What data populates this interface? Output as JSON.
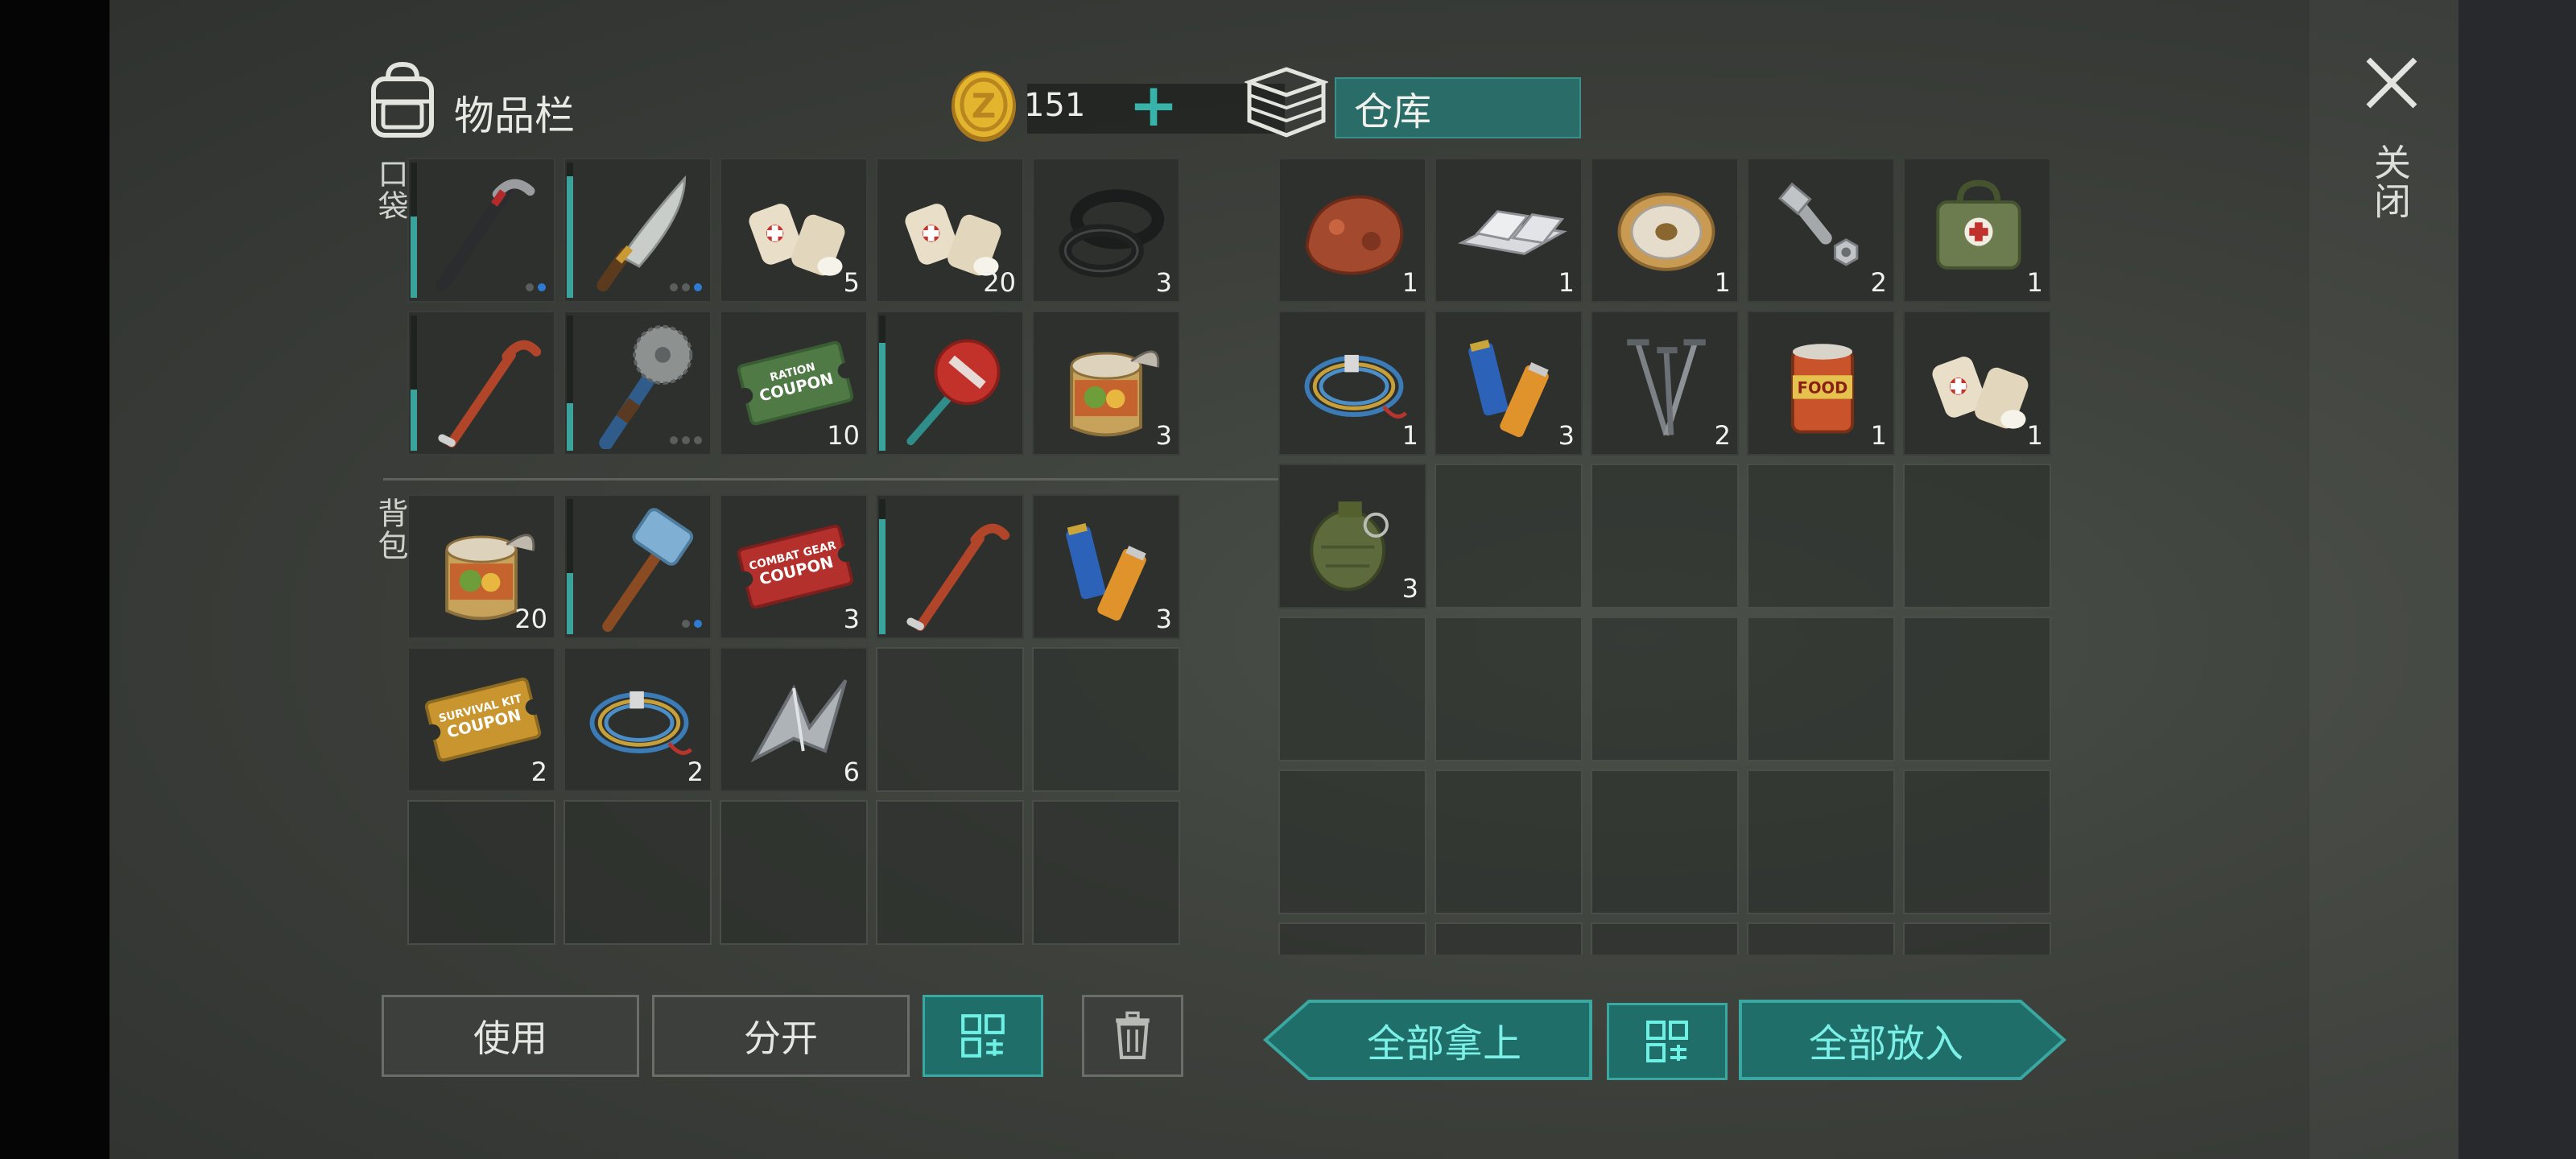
{
  "inventory": {
    "title": "物品栏",
    "coins": "151",
    "pocket_label": "口袋",
    "backpack_label": "背包"
  },
  "storage": {
    "title": "仓库"
  },
  "close_label": "关闭",
  "pocket_items": [
    {
      "name": "crowbar-bar",
      "count": "",
      "dots": [
        false,
        true
      ],
      "bar": 0.6
    },
    {
      "name": "machete",
      "count": "",
      "dots": [
        false,
        false,
        true
      ],
      "bar": 0.9
    },
    {
      "name": "bandage",
      "count": "5"
    },
    {
      "name": "bandage",
      "count": "20"
    },
    {
      "name": "rubber-ring",
      "count": "3"
    },
    {
      "name": "crowbar",
      "count": "",
      "bar": 0.45
    },
    {
      "name": "saw-club",
      "count": "",
      "dots": [
        false,
        false,
        false
      ],
      "bar": 0.35
    },
    {
      "name": "ration-coupon",
      "count": "10"
    },
    {
      "name": "stop-sign",
      "count": "",
      "bar": 0.8
    },
    {
      "name": "canned-food",
      "count": "3"
    }
  ],
  "backpack_items": [
    {
      "name": "canned-food",
      "count": "20"
    },
    {
      "name": "sledgehammer",
      "count": "",
      "dots": [
        false,
        true
      ],
      "bar": 0.45
    },
    {
      "name": "combat-coupon",
      "count": "3"
    },
    {
      "name": "crowbar",
      "count": "",
      "bar": 0.85
    },
    {
      "name": "batteries",
      "count": "3"
    },
    {
      "name": "survival-coupon",
      "count": "2"
    },
    {
      "name": "rope",
      "count": "2"
    },
    {
      "name": "scrap-metal",
      "count": "6"
    }
  ],
  "storage_items": [
    {
      "name": "ore",
      "count": "1"
    },
    {
      "name": "metal-ingot",
      "count": "1"
    },
    {
      "name": "wire-spool",
      "count": "1"
    },
    {
      "name": "bolt-nut",
      "count": "2"
    },
    {
      "name": "first-aid-bag",
      "count": "1"
    },
    {
      "name": "rope",
      "count": "1"
    },
    {
      "name": "batteries",
      "count": "3"
    },
    {
      "name": "nails",
      "count": "2"
    },
    {
      "name": "canned-food",
      "count": "1"
    },
    {
      "name": "bandage",
      "count": "1"
    },
    {
      "name": "grenade",
      "count": "3"
    }
  ],
  "coupon_text": {
    "ration": [
      "RATION",
      "COUPON"
    ],
    "combat": [
      "COMBAT GEAR",
      "COUPON"
    ],
    "survival": [
      "SURVIVAL KIT",
      "COUPON"
    ],
    "food": "FOOD"
  },
  "buttons": {
    "use": "使用",
    "split": "分开",
    "take_all": "全部拿上",
    "put_all": "全部放入"
  },
  "colors": {
    "accent": "#3aa7a1",
    "teal_fill": "#1f6e6a",
    "count_text": "#f1f1ee"
  }
}
